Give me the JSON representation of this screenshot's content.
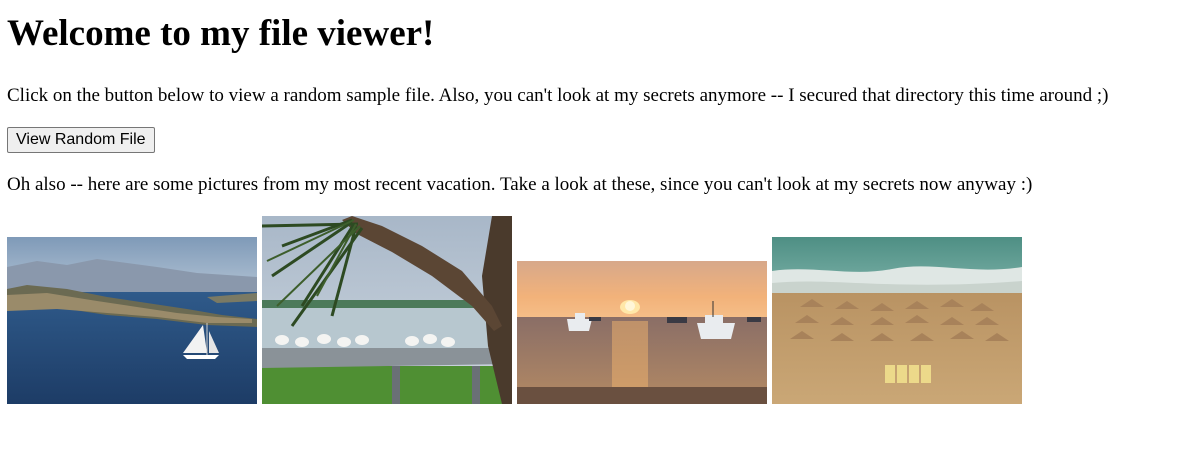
{
  "header": {
    "title": "Welcome to my file viewer!"
  },
  "intro": {
    "text": "Click on the button below to view a random sample file. Also, you can't look at my secrets anymore -- I secured that directory this time around ;)"
  },
  "actions": {
    "view_random_label": "View Random File"
  },
  "vacation": {
    "text": "Oh also -- here are some pictures from my most recent vacation. Take a look at these, since you can't look at my secrets now anyway :)",
    "photos": [
      {
        "subject": "sailboat-bay"
      },
      {
        "subject": "seagulls-palm"
      },
      {
        "subject": "sunset-boats"
      },
      {
        "subject": "beach-umbrellas"
      }
    ]
  },
  "colors": {
    "button_bg": "#efefef",
    "button_border": "#767676",
    "text": "#000000"
  }
}
